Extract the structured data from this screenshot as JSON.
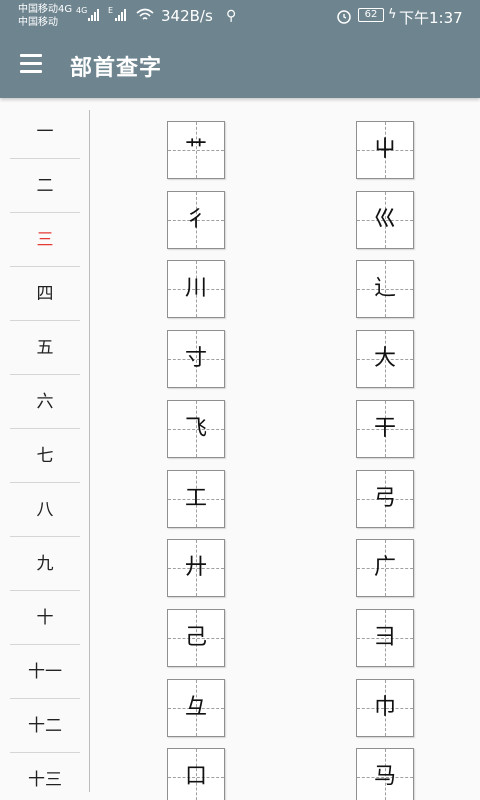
{
  "status": {
    "carrier_line1": "中国移动4G",
    "carrier_line2": "中国移动",
    "net_tag_1": "4G",
    "net_tag_2": "E",
    "speed": "342B/s",
    "battery": "62",
    "time": "下午1:37"
  },
  "header": {
    "title": "部首查字"
  },
  "strokes": [
    "一",
    "二",
    "三",
    "四",
    "五",
    "六",
    "七",
    "八",
    "九",
    "十",
    "十一",
    "十二",
    "十三"
  ],
  "selected_stroke": "三",
  "radicals": [
    "艹",
    "屮",
    "彳",
    "巛",
    "川",
    "辶",
    "寸",
    "大",
    "飞",
    "干",
    "工",
    "弓",
    "廾",
    "广",
    "己",
    "彐",
    "彑",
    "巾",
    "口",
    "马"
  ],
  "colors": {
    "bar": "#6e8590",
    "selected": "#e53935"
  },
  "icons": {
    "menu": "menu-icon",
    "wifi": "wifi-icon",
    "usb": "usb-icon",
    "alarm": "alarm-icon",
    "charge": "charging-icon"
  }
}
